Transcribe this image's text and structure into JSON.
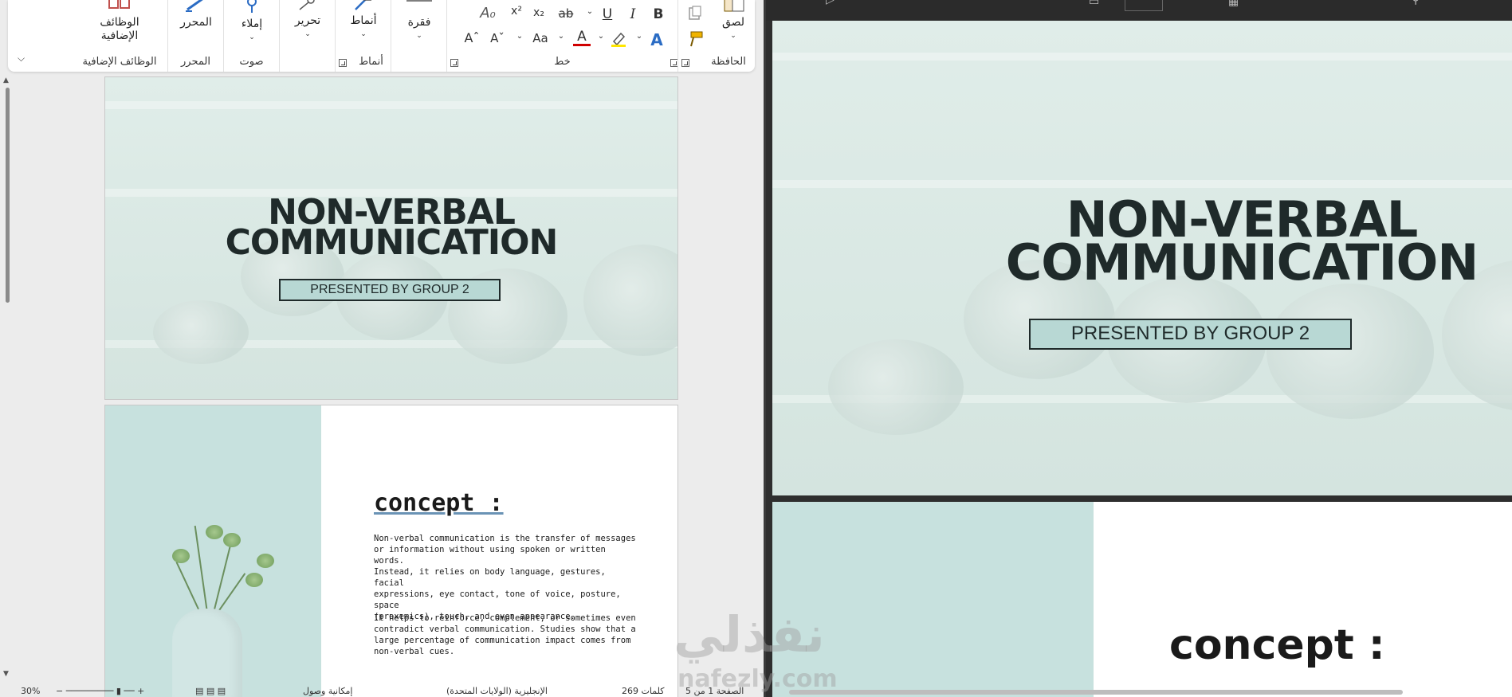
{
  "ribbon": {
    "groups": {
      "clipboard": {
        "label": "الحافظة",
        "paste": "لصق"
      },
      "font": {
        "label": "خط",
        "bold": "B",
        "italic": "I",
        "underline": "U",
        "strike": "ab",
        "subscript": "x₂",
        "superscript": "x²",
        "grow": "Aˆ",
        "shrink": "Aˇ",
        "case": "Aa",
        "color_a": "A",
        "effects": "A"
      },
      "paragraph": {
        "button": "فقرة"
      },
      "styles": {
        "label": "أنماط",
        "button": "أنماط"
      },
      "editing": {
        "button": "تحرير"
      },
      "voice": {
        "label": "صوت",
        "dictate": "إملاء"
      },
      "editor": {
        "label": "المحرر",
        "button": "المحرر"
      },
      "addins": {
        "label": "الوظائف الإضافية",
        "button": "الوظائف الإضافية"
      }
    }
  },
  "document": {
    "page1": {
      "title_line1": "NON-VERBAL",
      "title_line2": "COMMUNICATION",
      "subtitle": "PRESENTED BY GROUP 2"
    },
    "page2": {
      "heading": "concept :",
      "para1": "Non-verbal communication is the transfer of messages\nor information without using spoken or written words.\nInstead, it relies on body language, gestures, facial\nexpressions, eye contact, tone of voice, posture, space\n(proxemics), touch, and even appearance.",
      "para2": "It helps to reinforce, complement, or sometimes even\ncontradict verbal communication. Studies show that a\nlarge percentage of communication impact comes from\nnon-verbal cues."
    }
  },
  "statusbar": {
    "zoom": "30%",
    "words": "269 كلمات",
    "page": "الصفحة 1 من 5",
    "accessibility": "إمكانية وصول",
    "language": "الإنجليزية (الولايات المتحدة)"
  },
  "presentation": {
    "slide1": {
      "title_line1": "NON-VERBAL",
      "title_line2": "COMMUNICATION",
      "subtitle": "PRESENTED BY GROUP 2"
    },
    "slide2": {
      "heading": "concept :"
    }
  },
  "watermark": {
    "ar": "نفذلي",
    "en": "nafezly.com"
  },
  "colors": {
    "title": "#1f2a2a",
    "subtitle_bg": "#b8d8d4",
    "panel": "#c7e1de",
    "accent_underline": "#6a93b5"
  }
}
